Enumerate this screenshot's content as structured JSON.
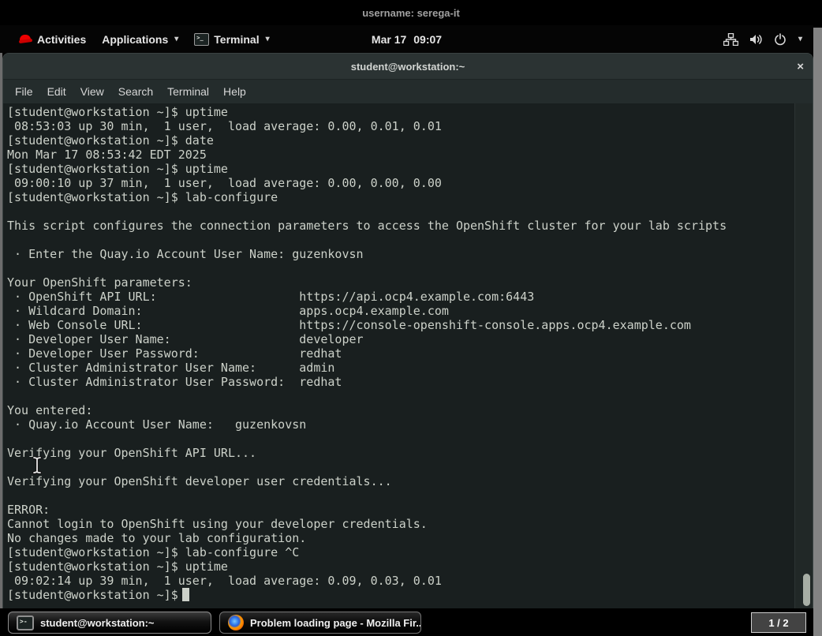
{
  "remote_header": {
    "title": "username: serega-it"
  },
  "panel": {
    "activities_label": "Activities",
    "applications_label": "Applications",
    "terminal_menu_label": "Terminal",
    "clock_date": "Mar 17",
    "clock_time": "09:07",
    "caret_glyph": "▾"
  },
  "window": {
    "title": "student@workstation:~",
    "close_glyph": "×",
    "menu_items": [
      "File",
      "Edit",
      "View",
      "Search",
      "Terminal",
      "Help"
    ]
  },
  "terminal": {
    "lines": [
      "[student@workstation ~]$ uptime",
      " 08:53:03 up 30 min,  1 user,  load average: 0.00, 0.01, 0.01",
      "[student@workstation ~]$ date",
      "Mon Mar 17 08:53:42 EDT 2025",
      "[student@workstation ~]$ uptime",
      " 09:00:10 up 37 min,  1 user,  load average: 0.00, 0.00, 0.00",
      "[student@workstation ~]$ lab-configure",
      "",
      "This script configures the connection parameters to access the OpenShift cluster for your lab scripts",
      "",
      " · Enter the Quay.io Account User Name: guzenkovsn",
      "",
      "Your OpenShift parameters:",
      " · OpenShift API URL:                    https://api.ocp4.example.com:6443",
      " · Wildcard Domain:                      apps.ocp4.example.com",
      " · Web Console URL:                      https://console-openshift-console.apps.ocp4.example.com",
      " · Developer User Name:                  developer",
      " · Developer User Password:              redhat",
      " · Cluster Administrator User Name:      admin",
      " · Cluster Administrator User Password:  redhat",
      "",
      "You entered:",
      " · Quay.io Account User Name:   guzenkovsn",
      "",
      "Verifying your OpenShift API URL...",
      "",
      "Verifying your OpenShift developer user credentials...",
      "",
      "ERROR:",
      "Cannot login to OpenShift using your developer credentials.",
      "No changes made to your lab configuration.",
      "[student@workstation ~]$ lab-configure ^C",
      "[student@workstation ~]$ uptime",
      " 09:02:14 up 39 min,  1 user,  load average: 0.09, 0.03, 0.01",
      "[student@workstation ~]$ "
    ]
  },
  "taskbar": {
    "window1_label": "student@workstation:~",
    "window2_label": "Problem loading page - Mozilla Fir...",
    "pager_label": "1 / 2"
  },
  "colors": {
    "panel_bg": "#050505",
    "titlebar_bg": "#2b3333",
    "menubar_bg": "#242c2c",
    "terminal_bg": "#191f1f",
    "terminal_text": "#ccd1c9",
    "desktop_edge": "#838383",
    "redhat_red": "#ee0000"
  }
}
